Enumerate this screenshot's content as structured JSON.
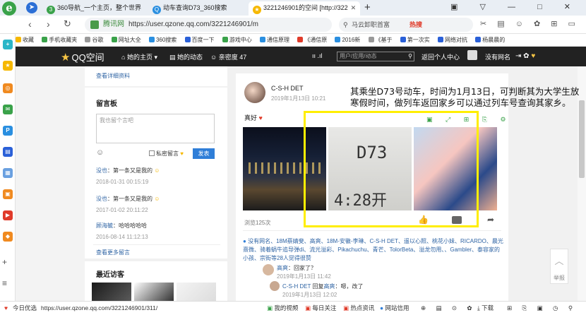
{
  "browser": {
    "tabs": [
      {
        "label": "360导航_一个主页，整个世界",
        "icon": "360-icon",
        "color": "#3aa24a"
      },
      {
        "label": "动车查询D73_360搜索",
        "icon": "search-q-icon",
        "color": "#2a8fe0"
      },
      {
        "label": "3221246901的空间 [http://322",
        "icon": "qzone-star-icon",
        "color": "#f6b800"
      }
    ],
    "new_tab": "+",
    "url_badge": "腾讯网",
    "url": "https://user.qzone.qq.com/3221246901/m",
    "search_placeholder": "马云卸职首富",
    "search_hot": "热搜",
    "bookmarks": [
      {
        "label": "收藏",
        "color": "#f6b800"
      },
      {
        "label": "手机收藏夹",
        "color": "#3aa24a"
      },
      {
        "label": "谷歌",
        "color": "#999"
      },
      {
        "label": "网址大全",
        "color": "#3aa24a"
      },
      {
        "label": "360搜索",
        "color": "#2a8fe0"
      },
      {
        "label": "百度一下",
        "color": "#2a60d8"
      },
      {
        "label": "游戏中心",
        "color": "#3aa24a"
      },
      {
        "label": "通信原理",
        "color": "#2a8fe0"
      },
      {
        "label": "《通信原",
        "color": "#e03b2a"
      },
      {
        "label": "2016新",
        "color": "#2a8fe0"
      },
      {
        "label": "《基于",
        "color": "#999"
      },
      {
        "label": "第一次实",
        "color": "#2a60d8"
      },
      {
        "label": "网络对抗",
        "color": "#2a60d8"
      },
      {
        "label": "杨晨晨的",
        "color": "#2a60d8"
      }
    ]
  },
  "qzone": {
    "logo": "QQ空间",
    "nav": [
      "她的主页",
      "她的动态",
      "亲密度 47"
    ],
    "search_placeholder": "用户/应用/动态",
    "personal_center": "返回个人中心",
    "username": "没有网名"
  },
  "left": {
    "view_profile": "查看详细资料",
    "guestbook_title": "留言板",
    "guestbook_placeholder": "我也留个言吧",
    "private_label": "私密留言",
    "send_label": "发表",
    "messages": [
      {
        "who": "没也",
        "text": "：第一条又是我的",
        "date": "2018-01-31 00:15:19"
      },
      {
        "who": "没也",
        "text": "：第一条又是我的",
        "date": "2017-01-02 20:11:22"
      },
      {
        "who": "顾海毓",
        "text": "：哈哈哈哈哈",
        "date": "2016-08-14 11:12:13"
      }
    ],
    "more_messages": "查看更多留言",
    "visitors_title": "最近访客"
  },
  "post": {
    "author": "C-S-H DET",
    "time": "2019年1月13日 10:21",
    "text": "真好",
    "ticket_code": "D73",
    "ticket_time": "4:28开",
    "views": "浏览125次",
    "likes_line": "没有网名、18M蔡婧斐、高爽、18M-安徽-李琳、C-S-H DET、遥以心照、桃花小妹、RICARDO、晨光熹微、骑着蜗牛追导弹di、流光溢彩、Pikachuchu、青芒、TolorBeta、溢龙勿用、、Gambler、泰容家的小孩、宗街等28人觉得很赞",
    "comments": [
      {
        "who": "高爽",
        "text": "：回家了？",
        "date": "2019年1月13日 11:42"
      },
      {
        "who": "C-S-H DET",
        "reply_to": "高爽",
        "text": "：嗯，改了",
        "date": "2019年1月13日 12:02"
      }
    ]
  },
  "annotation": "其乘坐D73号动车，时间为1月13日，可判断其为大学生放寒假时间，做列车返回家乡可以通过列车号查询其家乡。",
  "back_to_top": "举报",
  "status": {
    "left": "今日优选",
    "link": "https://user.qzone.qq.com/3221246901/311/",
    "items": [
      "我的视频",
      "每日关注",
      "热点资讯",
      "网站信用",
      "下载"
    ]
  }
}
